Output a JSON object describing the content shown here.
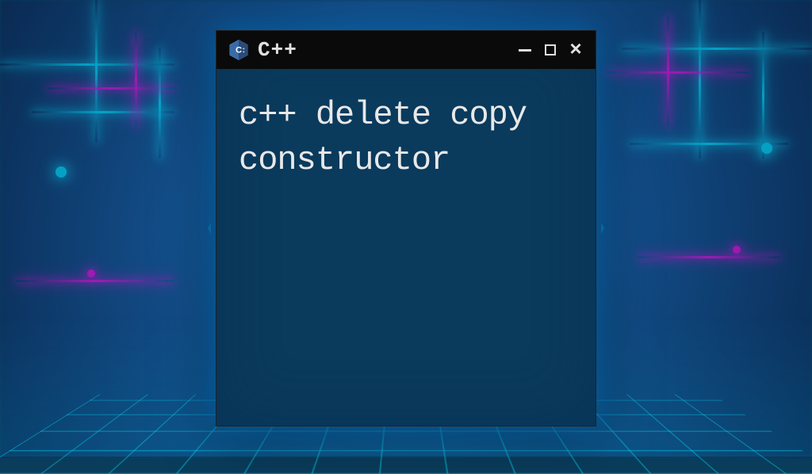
{
  "window": {
    "title": "C++",
    "body_text": "c++ delete copy constructor",
    "icon_name": "cpp-logo-icon"
  },
  "controls": {
    "minimize": "minimize",
    "maximize": "maximize",
    "close": "close"
  },
  "colors": {
    "window_bg": "#0a3a5c",
    "titlebar_bg": "#0a0a0a",
    "text": "#e8e8e8",
    "neon_cyan": "#00e5ff",
    "neon_pink": "#ff00dd"
  }
}
